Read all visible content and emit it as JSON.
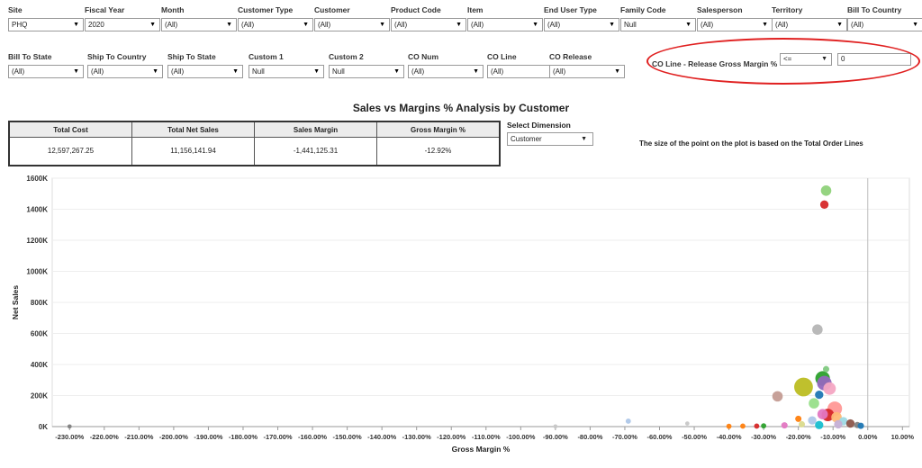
{
  "filters_row1": [
    {
      "label": "Site",
      "value": "PHQ"
    },
    {
      "label": "Fiscal Year",
      "value": "2020"
    },
    {
      "label": "Month",
      "value": "(All)"
    },
    {
      "label": "Customer Type",
      "value": "(All)"
    },
    {
      "label": "Customer",
      "value": "(All)"
    },
    {
      "label": "Product Code",
      "value": "(All)"
    },
    {
      "label": "Item",
      "value": "(All)"
    },
    {
      "label": "End User Type",
      "value": "(All)"
    },
    {
      "label": "Family Code",
      "value": "Null"
    },
    {
      "label": "Salesperson",
      "value": "(All)"
    },
    {
      "label": "Territory",
      "value": "(All)"
    },
    {
      "label": "Bill To Country",
      "value": "(All)"
    }
  ],
  "filters_row2": [
    {
      "label": "Bill To State",
      "value": "(All)"
    },
    {
      "label": "Ship To Country",
      "value": "(All)"
    },
    {
      "label": "Ship To State",
      "value": "(All)"
    },
    {
      "label": "Custom 1",
      "value": "Null"
    },
    {
      "label": "Custom 2",
      "value": "Null"
    },
    {
      "label": "CO Num",
      "value": "(All)"
    },
    {
      "label": "CO Line",
      "value": "(All)"
    },
    {
      "label": "CO Release",
      "value": "(All)"
    }
  ],
  "margin_filter": {
    "label": "CO Line - Release Gross Margin %",
    "operator": "<=",
    "value": "0",
    "highlight_color": "#e02020"
  },
  "title": "Sales vs Margins % Analysis by Customer",
  "kpi": {
    "headers": [
      "Total Cost",
      "Total Net Sales",
      "Sales Margin",
      "Gross Margin %"
    ],
    "values": [
      "12,597,267.25",
      "11,156,141.94",
      "-1,441,125.31",
      "-12.92%"
    ]
  },
  "dimension": {
    "label": "Select Dimension",
    "value": "Customer"
  },
  "size_note": "The size of the point on the plot is based on the Total Order Lines",
  "chart_data": {
    "type": "scatter",
    "xlabel": "Gross Margin %",
    "ylabel": "Net Sales",
    "xlim": [
      -235,
      12
    ],
    "ylim": [
      0,
      1600000
    ],
    "x_ticks": [
      -230,
      -220,
      -210,
      -200,
      -190,
      -180,
      -170,
      -160,
      -150,
      -140,
      -130,
      -120,
      -110,
      -100,
      -90,
      -80,
      -70,
      -60,
      -50,
      -40,
      -30,
      -20,
      -10,
      0,
      10
    ],
    "x_tick_labels": [
      "-230.00%",
      "-220.00%",
      "-210.00%",
      "-200.00%",
      "-190.00%",
      "-180.00%",
      "-170.00%",
      "-160.00%",
      "-150.00%",
      "-140.00%",
      "-130.00%",
      "-120.00%",
      "-110.00%",
      "-100.00%",
      "-90.00%",
      "-80.00%",
      "-70.00%",
      "-60.00%",
      "-50.00%",
      "-40.00%",
      "-30.00%",
      "-20.00%",
      "-10.00%",
      "0.00%",
      "10.00%"
    ],
    "y_ticks": [
      0,
      200000,
      400000,
      600000,
      800000,
      1000000,
      1200000,
      1400000,
      1600000
    ],
    "y_tick_labels": [
      "0K",
      "200K",
      "400K",
      "600K",
      "800K",
      "1000K",
      "1200K",
      "1400K",
      "1600K"
    ],
    "points": [
      {
        "x": -12,
        "y": 1520000,
        "size": 4,
        "color": "#8fd27a"
      },
      {
        "x": -12.5,
        "y": 1430000,
        "size": 3,
        "color": "#d62728"
      },
      {
        "x": -14.5,
        "y": 625000,
        "size": 4,
        "color": "#b5b5b5"
      },
      {
        "x": -12,
        "y": 370000,
        "size": 2,
        "color": "#7fc97f"
      },
      {
        "x": -13,
        "y": 310000,
        "size": 6,
        "color": "#2ca02c"
      },
      {
        "x": -12.5,
        "y": 280000,
        "size": 6,
        "color": "#9467bd"
      },
      {
        "x": -11,
        "y": 245000,
        "size": 5,
        "color": "#f4a6c3"
      },
      {
        "x": -18.5,
        "y": 255000,
        "size": 8,
        "color": "#bcbd22"
      },
      {
        "x": -26,
        "y": 195000,
        "size": 4,
        "color": "#c49c94"
      },
      {
        "x": -14,
        "y": 205000,
        "size": 3,
        "color": "#1f77b4"
      },
      {
        "x": -15.5,
        "y": 150000,
        "size": 4,
        "color": "#98df8a"
      },
      {
        "x": -9.5,
        "y": 115000,
        "size": 6,
        "color": "#ff9896"
      },
      {
        "x": -11.5,
        "y": 75000,
        "size": 5,
        "color": "#d62728"
      },
      {
        "x": -13,
        "y": 80000,
        "size": 4,
        "color": "#e377c2"
      },
      {
        "x": -9,
        "y": 60000,
        "size": 4,
        "color": "#ffbb78"
      },
      {
        "x": -20,
        "y": 50000,
        "size": 2,
        "color": "#ff7f0e"
      },
      {
        "x": -16,
        "y": 40000,
        "size": 3,
        "color": "#aec7e8"
      },
      {
        "x": -7,
        "y": 35000,
        "size": 3,
        "color": "#9edae5"
      },
      {
        "x": -5,
        "y": 20000,
        "size": 3,
        "color": "#8c564b"
      },
      {
        "x": -8.5,
        "y": 15000,
        "size": 3,
        "color": "#c5b0d5"
      },
      {
        "x": -14,
        "y": 10000,
        "size": 3,
        "color": "#17becf"
      },
      {
        "x": -3,
        "y": 10000,
        "size": 2,
        "color": "#7f7f7f"
      },
      {
        "x": -19,
        "y": 15000,
        "size": 2,
        "color": "#dbdb8d"
      },
      {
        "x": -24,
        "y": 8000,
        "size": 2,
        "color": "#e377c2"
      },
      {
        "x": -2,
        "y": 5000,
        "size": 2,
        "color": "#1f77b4"
      },
      {
        "x": -30,
        "y": 5000,
        "size": 1.5,
        "color": "#2ca02c"
      },
      {
        "x": -32,
        "y": 3000,
        "size": 1.5,
        "color": "#d62728"
      },
      {
        "x": -36,
        "y": 3000,
        "size": 1.5,
        "color": "#ff7f0e"
      },
      {
        "x": -40,
        "y": 2000,
        "size": 1.5,
        "color": "#ff7f0e"
      },
      {
        "x": -69,
        "y": 35000,
        "size": 1.5,
        "color": "#aec7e8"
      },
      {
        "x": -52,
        "y": 20000,
        "size": 1,
        "color": "#c7c7c7"
      },
      {
        "x": -90,
        "y": 1000,
        "size": 1,
        "color": "#c7c7c7"
      },
      {
        "x": -230,
        "y": 1000,
        "size": 1,
        "color": "#7f7f7f"
      }
    ]
  }
}
